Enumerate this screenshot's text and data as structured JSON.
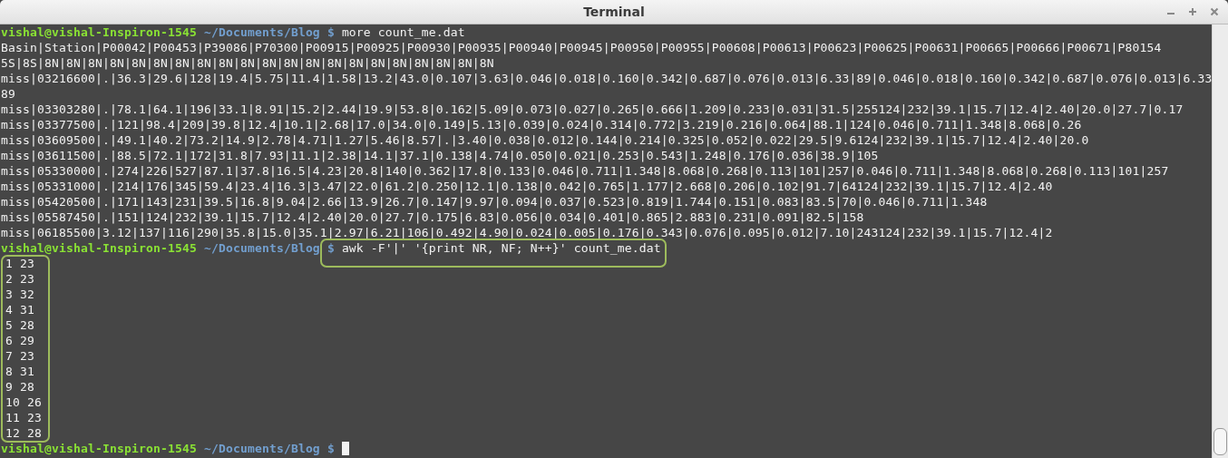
{
  "window": {
    "title": "Terminal"
  },
  "terminal": {
    "lines": [
      {
        "kind": "prompt",
        "user_host": "vishal@vishal-Inspiron-1545",
        "path": "~/Documents/Blog",
        "symbol": "$",
        "command": "more count_me.dat",
        "highlighted": false,
        "cursor": false
      },
      {
        "kind": "output",
        "text": "Basin|Station|P00042|P00453|P39086|P70300|P00915|P00925|P00930|P00935|P00940|P00945|P00950|P00955|P00608|P00613|P00623|P00625|P00631|P00665|P00666|P00671|P80154"
      },
      {
        "kind": "output",
        "text": "5S|8S|8N|8N|8N|8N|8N|8N|8N|8N|8N|8N|8N|8N|8N|8N|8N|8N|8N|8N|8N|8N|8N"
      },
      {
        "kind": "output",
        "text": "miss|03216600|.|36.3|29.6|128|19.4|5.75|11.4|1.58|13.2|43.0|0.107|3.63|0.046|0.018|0.160|0.342|0.687|0.076|0.013|6.33|89|0.046|0.018|0.160|0.342|0.687|0.076|0.013|6.33"
      },
      {
        "kind": "output",
        "text": "89"
      },
      {
        "kind": "output",
        "text": "miss|03303280|.|78.1|64.1|196|33.1|8.91|15.2|2.44|19.9|53.8|0.162|5.09|0.073|0.027|0.265|0.666|1.209|0.233|0.031|31.5|255124|232|39.1|15.7|12.4|2.40|20.0|27.7|0.17"
      },
      {
        "kind": "output",
        "text": "miss|03377500|.|121|98.4|209|39.8|12.4|10.1|2.68|17.0|34.0|0.149|5.13|0.039|0.024|0.314|0.772|3.219|0.216|0.064|88.1|124|0.046|0.711|1.348|8.068|0.26"
      },
      {
        "kind": "output",
        "text": "miss|03609500|.|49.1|40.2|73.2|14.9|2.78|4.71|1.27|5.46|8.57|.|3.40|0.038|0.012|0.144|0.214|0.325|0.052|0.022|29.5|9.6124|232|39.1|15.7|12.4|2.40|20.0"
      },
      {
        "kind": "output",
        "text": "miss|03611500|.|88.5|72.1|172|31.8|7.93|11.1|2.38|14.1|37.1|0.138|4.74|0.050|0.021|0.253|0.543|1.248|0.176|0.036|38.9|105"
      },
      {
        "kind": "output",
        "text": "miss|05330000|.|274|226|527|87.1|37.8|16.5|4.23|20.8|140|0.362|17.8|0.133|0.046|0.711|1.348|8.068|0.268|0.113|101|257|0.046|0.711|1.348|8.068|0.268|0.113|101|257"
      },
      {
        "kind": "output",
        "text": "miss|05331000|.|214|176|345|59.4|23.4|16.3|3.47|22.0|61.2|0.250|12.1|0.138|0.042|0.765|1.177|2.668|0.206|0.102|91.7|64124|232|39.1|15.7|12.4|2.40"
      },
      {
        "kind": "output",
        "text": "miss|05420500|.|171|143|231|39.5|16.8|9.04|2.66|13.9|26.7|0.147|9.97|0.094|0.037|0.523|0.819|1.744|0.151|0.083|83.5|70|0.046|0.711|1.348"
      },
      {
        "kind": "output",
        "text": "miss|05587450|.|151|124|232|39.1|15.7|12.4|2.40|20.0|27.7|0.175|6.83|0.056|0.034|0.401|0.865|2.883|0.231|0.091|82.5|158"
      },
      {
        "kind": "output",
        "text": "miss|06185500|3.12|137|116|290|35.8|15.0|35.1|2.97|6.21|106|0.492|4.90|0.024|0.005|0.176|0.343|0.076|0.095|0.012|7.10|243124|232|39.1|15.7|12.4|2"
      },
      {
        "kind": "prompt",
        "user_host": "vishal@vishal-Inspiron-1545",
        "path": "~/Documents/Blog",
        "symbol": "$",
        "command": "awk -F'|' '{print NR, NF; N++}' count_me.dat",
        "highlighted": true,
        "cursor": false
      },
      {
        "kind": "output_group",
        "highlighted": true,
        "lines": [
          "1 23",
          "2 23",
          "3 32",
          "4 31",
          "5 28",
          "6 29",
          "7 23",
          "8 31",
          "9 28",
          "10 26",
          "11 23",
          "12 28"
        ]
      },
      {
        "kind": "prompt",
        "user_host": "vishal@vishal-Inspiron-1545",
        "path": "~/Documents/Blog",
        "symbol": "$",
        "highlighted": false,
        "cursor": true
      }
    ]
  }
}
